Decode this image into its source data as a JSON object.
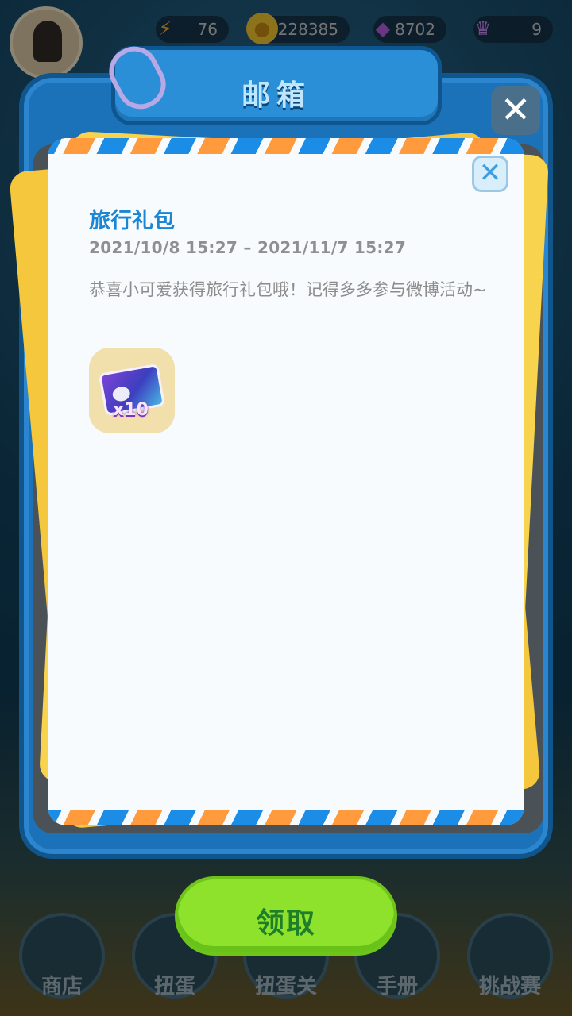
{
  "hud": {
    "energy": "76",
    "coins": "228385",
    "gems": "8702",
    "crowns": "9"
  },
  "mailbox": {
    "title": "邮箱"
  },
  "mail": {
    "title": "旅行礼包",
    "time_range": "2021/10/8  15:27 – 2021/11/7  15:27",
    "body": "恭喜小可爱获得旅行礼包哦！记得多多参与微博活动~",
    "reward_count": "x10"
  },
  "actions": {
    "claim_label": "领取"
  },
  "nav": {
    "items": [
      {
        "label": "商店"
      },
      {
        "label": "扭蛋"
      },
      {
        "label": "扭蛋关"
      },
      {
        "label": "手册"
      },
      {
        "label": "挑战赛"
      }
    ]
  }
}
